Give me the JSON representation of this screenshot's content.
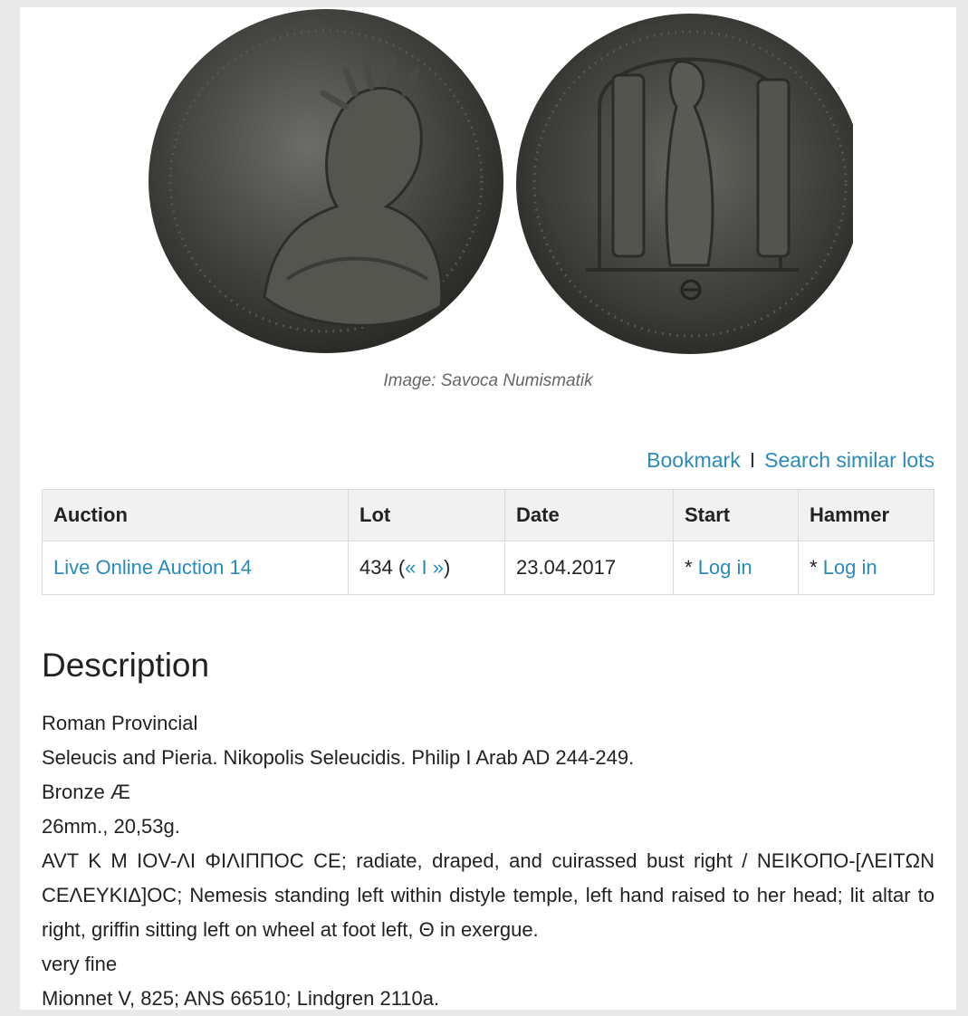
{
  "image": {
    "caption": "Image: Savoca Numismatik"
  },
  "actions": {
    "bookmark": "Bookmark",
    "separator": "I",
    "search_similar": "Search similar lots"
  },
  "lot_table": {
    "headers": [
      "Auction",
      "Lot",
      "Date",
      "Start",
      "Hammer"
    ],
    "row": {
      "auction": "Live Online Auction 14",
      "lot_number": "434 (",
      "lot_prev": "«",
      "lot_sep": " I ",
      "lot_next": "»",
      "lot_close": ")",
      "date": "23.04.2017",
      "start_prefix": "* ",
      "start_link": "Log in",
      "hammer_prefix": "* ",
      "hammer_link": "Log in"
    }
  },
  "description": {
    "title": "Description",
    "lines": [
      "Roman Provincial",
      "Seleucis and Pieria. Nikopolis Seleucidis. Philip I Arab AD 244-249.",
      "Bronze Æ",
      "26mm., 20,53g.",
      "AVT K M IOV-ΛI ΦIΛIΠΠOC CE; radiate, draped, and cuirassed bust right / NEIKOΠO-[ΛEITΩN CEΛEYKIΔ]OC; Nemesis standing left within distyle temple, left hand raised to her head; lit altar to right, griffin sitting left on wheel at foot left, Θ in exergue.",
      "very fine",
      "Mionnet V, 825; ANS 66510; Lindgren 2110a."
    ]
  }
}
